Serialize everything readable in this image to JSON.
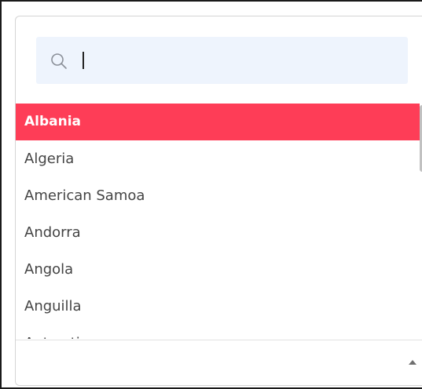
{
  "search": {
    "value": "",
    "icon": "search-icon"
  },
  "countries": [
    {
      "label": "Albania",
      "selected": true
    },
    {
      "label": "Algeria",
      "selected": false
    },
    {
      "label": "American Samoa",
      "selected": false
    },
    {
      "label": "Andorra",
      "selected": false
    },
    {
      "label": "Angola",
      "selected": false
    },
    {
      "label": "Anguilla",
      "selected": false
    },
    {
      "label": "Antarctica",
      "selected": false
    }
  ],
  "colors": {
    "selected_bg": "#fe3d57",
    "search_bg": "#eef4fd"
  },
  "scroll_control": {
    "icon": "chevron-up-icon"
  }
}
